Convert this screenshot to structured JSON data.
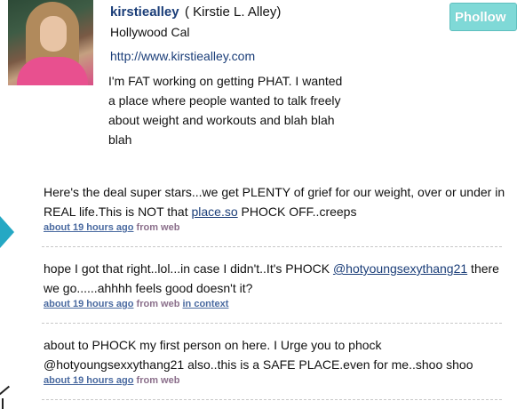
{
  "profile": {
    "screen_name": "kirstiealley",
    "full_name": "( Kirstie L. Alley)",
    "location": "Hollywood Cal",
    "website": "http://www.kirstiealley.com",
    "bio": "I'm FAT working on getting PHAT. I wanted a place where people wanted to talk freely about weight and workouts and blah blah blah"
  },
  "follow_button": {
    "label": "Phollow"
  },
  "tweets": [
    {
      "text_before": "Here's the deal super stars...we get PLENTY of grief for our weight, over or under in REAL life.This is NOT that ",
      "link": "place.so",
      "text_after": " PHOCK OFF..creeps",
      "time": "about 19 hours ago",
      "source": "from web"
    },
    {
      "text_before": "hope I got that right..lol...in case I didn't..It's PHOCK ",
      "link": "@hotyoungsexythang21",
      "text_after": " there we go......ahhhh feels good doesn't it?",
      "time": "about 19 hours ago",
      "source": "from web",
      "context": "in context"
    },
    {
      "text": "about to PHOCK my first person on here. I Urge you to phock @hotyoungsexxythang21 also..this is a SAFE PLACE.even for me..shoo shoo",
      "time": "about 19 hours ago",
      "source": "from web"
    }
  ],
  "colors": {
    "link": "#1a3d78",
    "follow_button": "#7fd9d7",
    "arrow": "#25a8c4",
    "source": "#8b6f8b"
  },
  "icons": {
    "arrow": "pager-arrow-icon"
  }
}
